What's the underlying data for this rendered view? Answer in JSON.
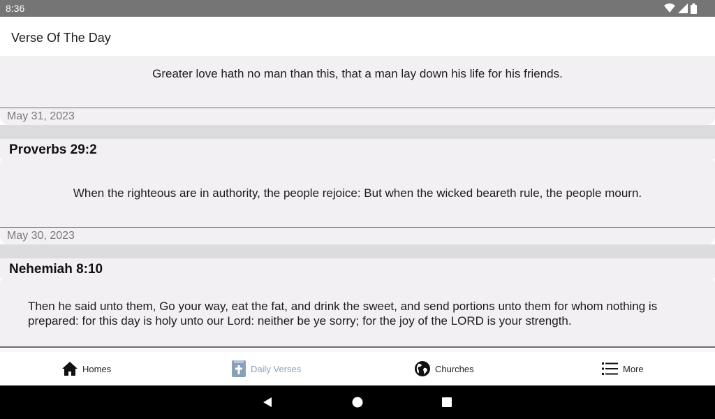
{
  "status_bar": {
    "time": "8:36"
  },
  "app_bar": {
    "title": "Verse Of The Day"
  },
  "verses": [
    {
      "text": "Greater love hath no man than this, that a man lay down his life for his friends."
    },
    {
      "date": "May 31, 2023",
      "reference": "Proverbs 29:2",
      "text": "When the righteous are in authority, the people rejoice: But when the wicked beareth rule, the people mourn."
    },
    {
      "date": "May 30, 2023",
      "reference": "Nehemiah 8:10",
      "text": "Then he said unto them, Go your way, eat the fat, and drink the sweet, and send portions unto them for whom nothing is prepared: for this day is holy unto our Lord: neither be ye sorry; for the joy of the LORD is your strength."
    }
  ],
  "bottom_nav": {
    "items": [
      {
        "label": "Homes",
        "icon": "home-icon"
      },
      {
        "label": "Daily Verses",
        "icon": "bible-icon",
        "active": true
      },
      {
        "label": "Churches",
        "icon": "globe-icon"
      },
      {
        "label": "More",
        "icon": "list-icon"
      }
    ],
    "active_color": "#8aa0b8"
  },
  "system_nav": {
    "buttons": [
      "back",
      "home",
      "recents"
    ]
  }
}
